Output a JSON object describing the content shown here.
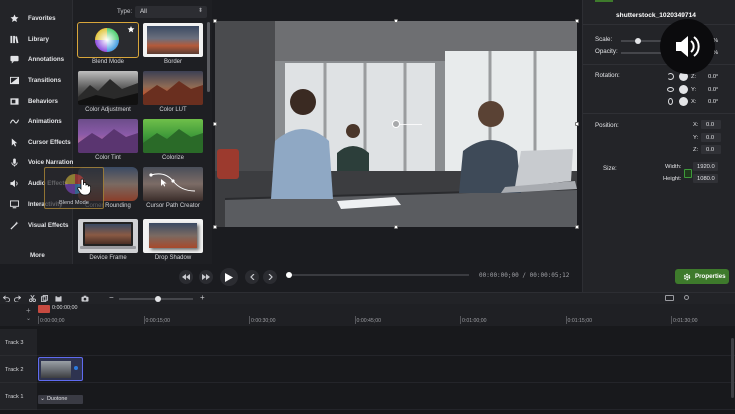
{
  "left_nav": {
    "items": [
      {
        "label": "Favorites",
        "icon": "star-icon"
      },
      {
        "label": "Library",
        "icon": "library-icon"
      },
      {
        "label": "Annotations",
        "icon": "annotation-icon"
      },
      {
        "label": "Transitions",
        "icon": "transition-icon"
      },
      {
        "label": "Behaviors",
        "icon": "behavior-icon"
      },
      {
        "label": "Animations",
        "icon": "animation-icon"
      },
      {
        "label": "Cursor Effects",
        "icon": "cursor-icon"
      },
      {
        "label": "Voice Narration",
        "icon": "microphone-icon"
      },
      {
        "label": "Audio Effects",
        "icon": "speaker-icon"
      },
      {
        "label": "Interactivity",
        "icon": "interactivity-icon"
      },
      {
        "label": "Visual Effects",
        "icon": "wand-icon"
      }
    ],
    "more_label": "More"
  },
  "effects_panel": {
    "type_label": "Type:",
    "type_value": "All",
    "tiles": [
      {
        "label": "Blend Mode"
      },
      {
        "label": "Border"
      },
      {
        "label": "Color Adjustment"
      },
      {
        "label": "Color LUT"
      },
      {
        "label": "Color Tint"
      },
      {
        "label": "Colorize"
      },
      {
        "label": "Corner Rounding"
      },
      {
        "label": "Cursor Path Creator"
      },
      {
        "label": "Device Frame"
      },
      {
        "label": "Drop Shadow"
      }
    ],
    "drag_ghost_label": "Blend Mode"
  },
  "properties": {
    "title": "shutterstock_1020349714",
    "scale_label": "Scale:",
    "scale_value": "%",
    "opacity_label": "Opacity:",
    "opacity_value": "%",
    "rotation_label": "Rotation:",
    "rotation": [
      {
        "axis": "Z:",
        "value": "0.0°"
      },
      {
        "axis": "Y:",
        "value": "0.0°"
      },
      {
        "axis": "X:",
        "value": "0.0°"
      }
    ],
    "position_label": "Position:",
    "position": [
      {
        "axis": "X:",
        "value": "0.0"
      },
      {
        "axis": "Y:",
        "value": "0.0"
      },
      {
        "axis": "Z:",
        "value": "0.0"
      }
    ],
    "size_label": "Size:",
    "width_label": "Width:",
    "width_value": "1920.0",
    "height_label": "Height:",
    "height_value": "1080.0",
    "button_label": "Properties"
  },
  "playback": {
    "timecode_current": "00:00:00;00",
    "timecode_separator": "/",
    "timecode_total": "00:00:05;12",
    "scrub_progress": 0.0
  },
  "timeline": {
    "playhead_time": "0:00:00;00",
    "ticks": [
      "0:00:00;00",
      "0:00:15;00",
      "0:00:30;00",
      "0:00:45;00",
      "0:01:00;00",
      "0:01:15;00",
      "0:01:30;00"
    ],
    "tracks": [
      {
        "label": "Track 3"
      },
      {
        "label": "Track 2"
      },
      {
        "label": "Track 1"
      }
    ],
    "track1_clip_label": "Duotone"
  },
  "colors": {
    "accent_selected": "#d8a63b",
    "properties_button": "#3e7a2c",
    "clip_border": "#5f6bf0"
  }
}
